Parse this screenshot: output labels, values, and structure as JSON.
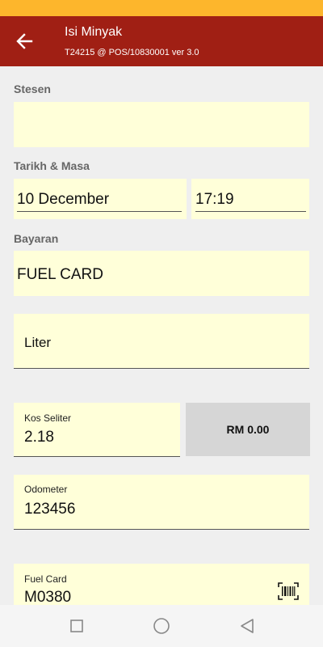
{
  "app_bar": {
    "title": "Isi Minyak",
    "subtitle": "T24215 @ POS/10830001 ver 3.0",
    "back_icon": "arrow-left-icon"
  },
  "colors": {
    "status_bar": "#fdb62c",
    "app_bar": "#a01f14",
    "field_bg": "#ffffd9",
    "total_bg": "#d6d6d6"
  },
  "form": {
    "station_label": "Stesen",
    "station_value": "",
    "datetime_label": "Tarikh & Masa",
    "date_value": "10 December",
    "time_value": "17:19",
    "payment_label": "Bayaran",
    "payment_value": "FUEL CARD",
    "liter_placeholder": "Liter",
    "cost_per_liter_label": "Kos Seliter",
    "cost_per_liter_value": "2.18",
    "total_value": "RM 0.00",
    "odometer_label": "Odometer",
    "odometer_value": "123456",
    "fuel_card_label": "Fuel Card",
    "fuel_card_value": "M0380",
    "barcode_icon": "barcode-scan-icon"
  },
  "nav": {
    "recent_icon": "square-icon",
    "home_icon": "circle-icon",
    "back_icon": "triangle-back-icon"
  }
}
